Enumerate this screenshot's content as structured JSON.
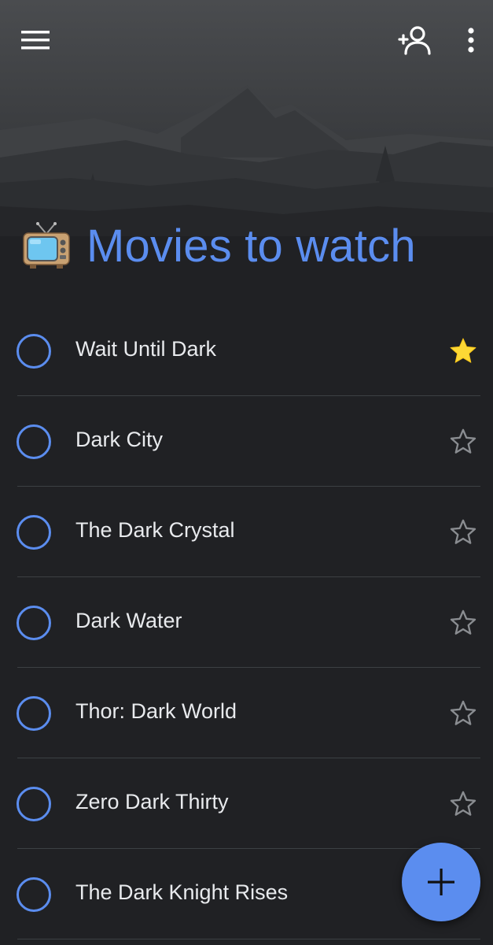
{
  "app_bar": {
    "menu_icon": "hamburger-menu-icon",
    "share_icon": "add-person-icon",
    "more_icon": "more-vertical-icon"
  },
  "list": {
    "emoji": "📺",
    "title": "Movies to watch",
    "accent_color": "#5b8def",
    "star_color": "#fdd835"
  },
  "tasks": [
    {
      "title": "Wait Until Dark",
      "starred": true
    },
    {
      "title": "Dark City",
      "starred": false
    },
    {
      "title": "The Dark Crystal",
      "starred": false
    },
    {
      "title": "Dark Water",
      "starred": false
    },
    {
      "title": "Thor: Dark World",
      "starred": false
    },
    {
      "title": "Zero Dark Thirty",
      "starred": false
    },
    {
      "title": "The Dark Knight Rises",
      "starred": false
    }
  ],
  "fab": {
    "icon": "plus-icon"
  }
}
